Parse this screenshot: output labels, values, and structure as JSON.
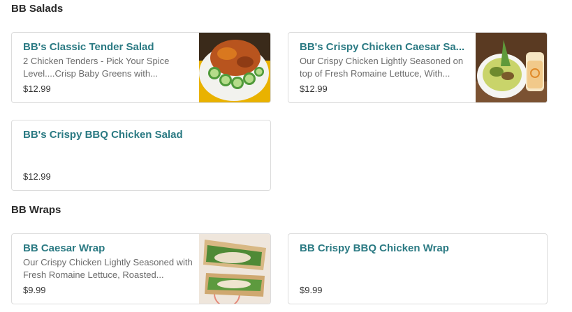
{
  "sections": [
    {
      "title": "BB Salads",
      "items": [
        {
          "name": "BB's Classic Tender Salad",
          "description": "2 Chicken Tenders - Pick Your Spice Level....Crisp Baby Greens with...",
          "price": "$12.99"
        },
        {
          "name": "BB's Crispy Chicken Caesar Sa...",
          "description": "Our Crispy Chicken Lightly Seasoned on top of Fresh Romaine Lettuce, With...",
          "price": "$12.99"
        },
        {
          "name": "BB's Crispy BBQ Chicken Salad",
          "description": "",
          "price": "$12.99"
        }
      ]
    },
    {
      "title": "BB Wraps",
      "items": [
        {
          "name": "BB Caesar Wrap",
          "description": "Our Crispy Chicken Lightly Seasoned with Fresh Romaine Lettuce, Roasted...",
          "price": "$9.99"
        },
        {
          "name": "BB Crispy BBQ Chicken Wrap",
          "description": "",
          "price": "$9.99"
        }
      ]
    }
  ]
}
